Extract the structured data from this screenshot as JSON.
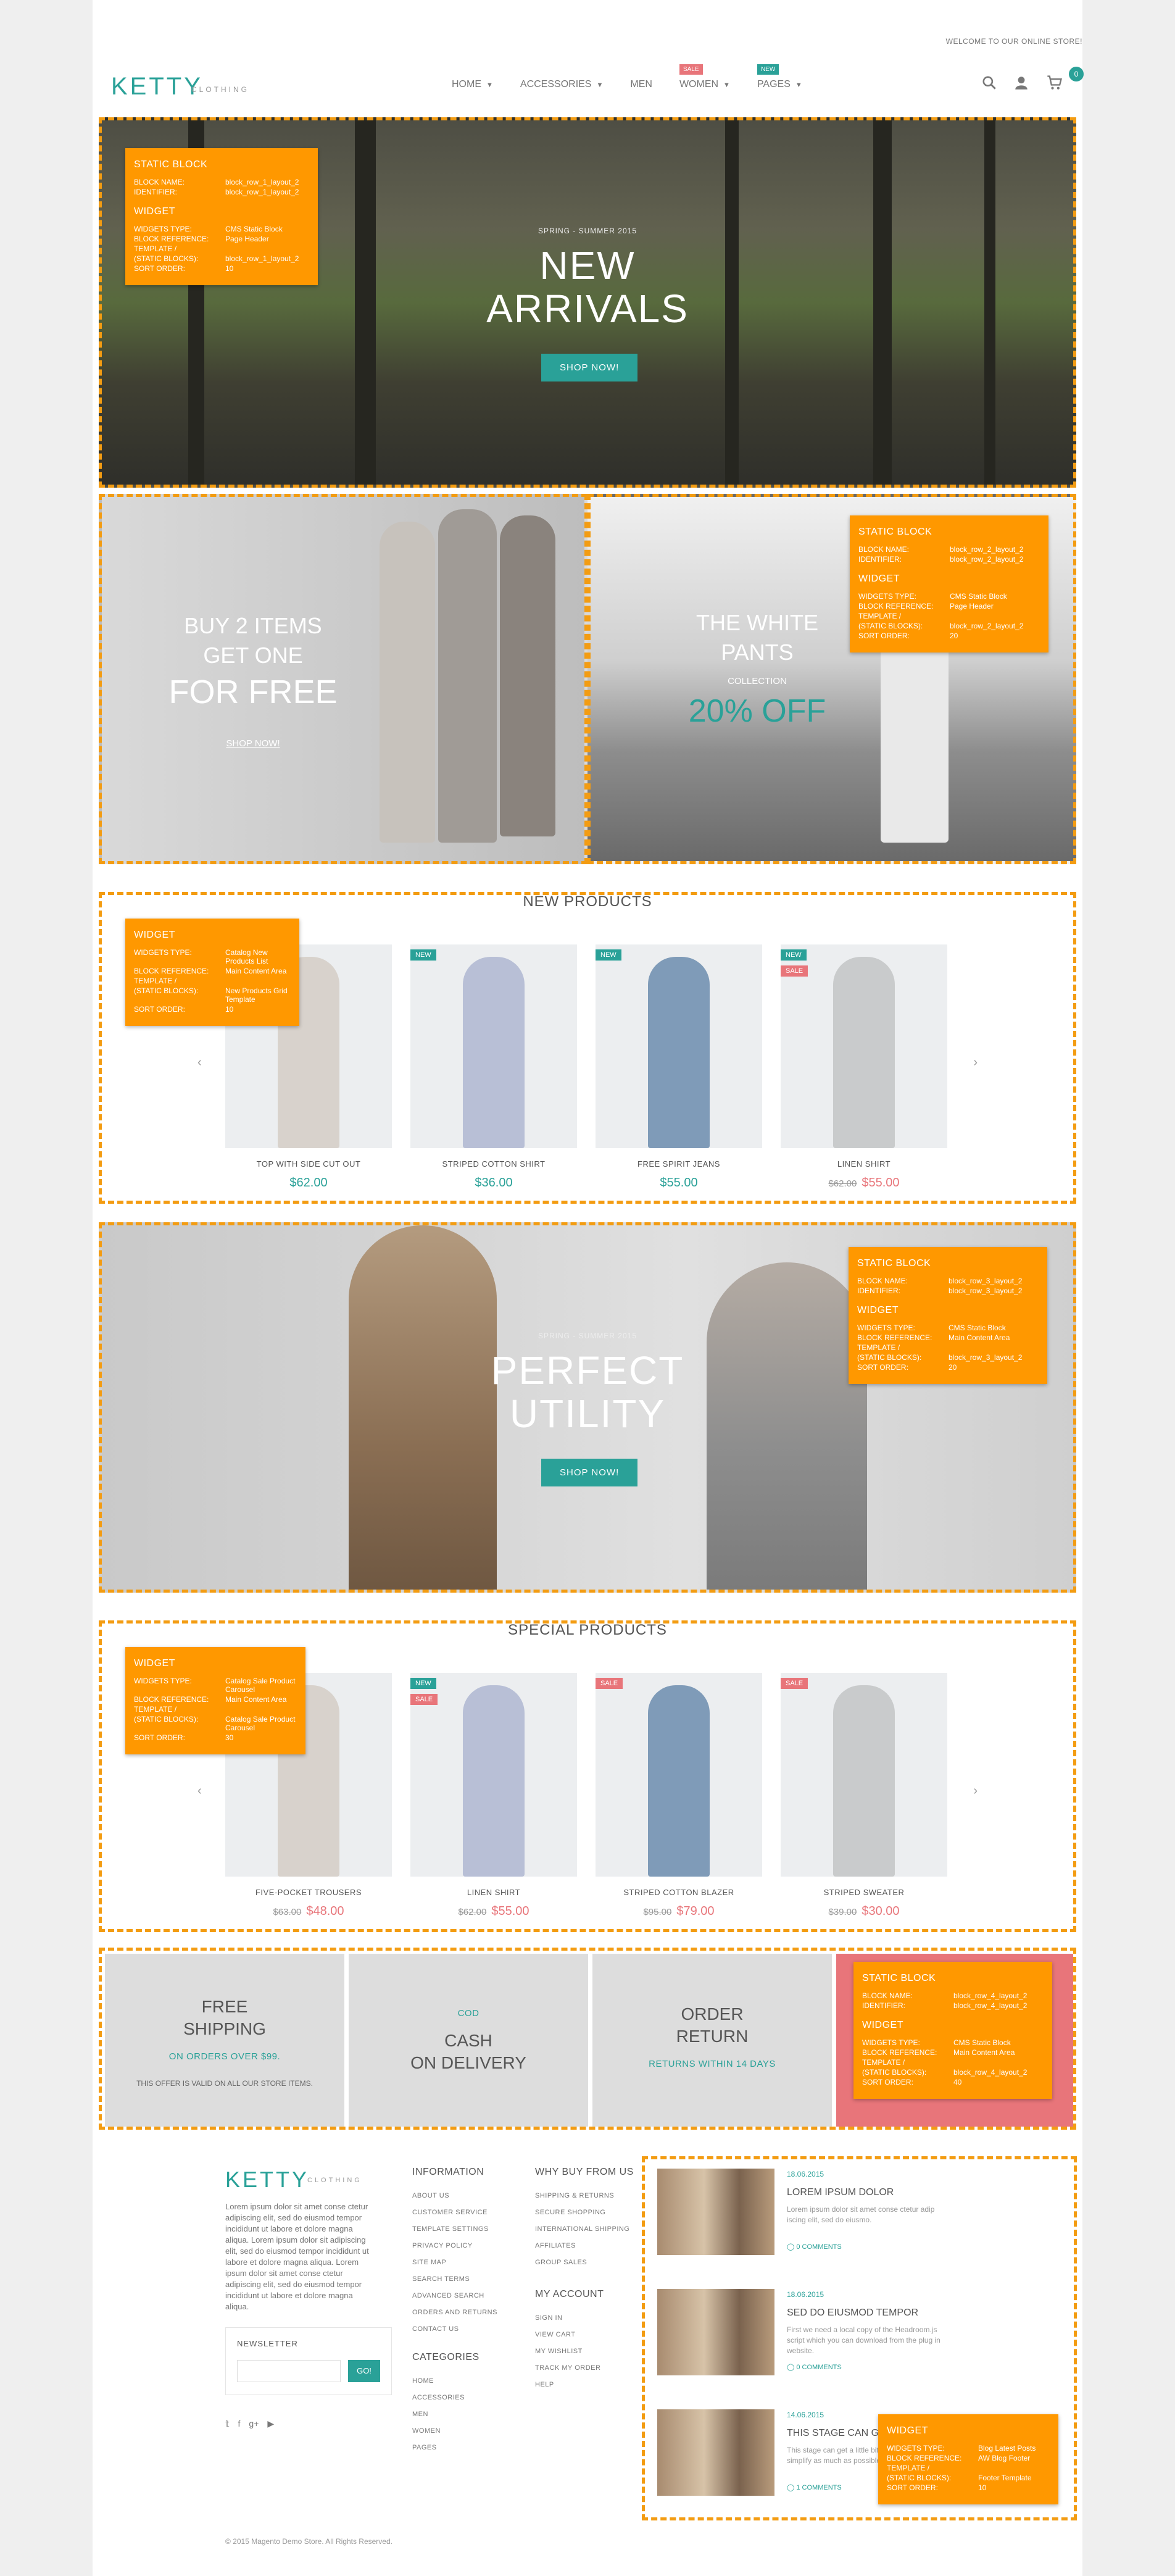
{
  "topbar": {
    "welcome": "WELCOME TO OUR ONLINE STORE!"
  },
  "header": {
    "logo": "KETTY",
    "logo_sub": "CLOTHING",
    "nav": [
      {
        "label": "HOME",
        "caret": true,
        "badge": ""
      },
      {
        "label": "ACCESSORIES",
        "caret": true,
        "badge": ""
      },
      {
        "label": "MEN",
        "caret": false,
        "badge": ""
      },
      {
        "label": "WOMEN",
        "caret": true,
        "badge": "SALE"
      },
      {
        "label": "PAGES",
        "caret": true,
        "badge": "NEW"
      }
    ],
    "cart_count": "0",
    "icons": [
      "search-icon",
      "user-icon",
      "cart-icon"
    ]
  },
  "hero": {
    "pretitle": "SPRING - SUMMER 2015",
    "title_line1": "NEW",
    "title_line2": "ARRIVALS",
    "button": "SHOP NOW!",
    "info": {
      "heading1": "STATIC BLOCK",
      "rows1": [
        [
          "BLOCK NAME:",
          "block_row_1_layout_2"
        ],
        [
          "IDENTIFIER:",
          "block_row_1_layout_2"
        ]
      ],
      "heading2": "WIDGET",
      "rows2": [
        [
          "WIDGETS TYPE:",
          "CMS Static Block"
        ],
        [
          "BLOCK REFERENCE:",
          "Page Header"
        ],
        [
          "TEMPLATE /",
          ""
        ],
        [
          "(STATIC BLOCKS):",
          "block_row_1_layout_2"
        ],
        [
          "SORT ORDER:",
          "10"
        ]
      ]
    }
  },
  "banners": {
    "left": {
      "line1": "BUY 2 ITEMS",
      "line2": "GET ONE",
      "line3": "FOR FREE",
      "link": "SHOP NOW!"
    },
    "right": {
      "line1": "THE WHITE",
      "line2": "PANTS",
      "line3": "COLLECTION",
      "line4": "20% OFF"
    },
    "info": {
      "heading1": "STATIC BLOCK",
      "rows1": [
        [
          "BLOCK NAME:",
          "block_row_2_layout_2"
        ],
        [
          "IDENTIFIER:",
          "block_row_2_layout_2"
        ]
      ],
      "heading2": "WIDGET",
      "rows2": [
        [
          "WIDGETS TYPE:",
          "CMS Static Block"
        ],
        [
          "BLOCK REFERENCE:",
          "Page Header"
        ],
        [
          "TEMPLATE /",
          ""
        ],
        [
          "(STATIC BLOCKS):",
          "block_row_2_layout_2"
        ],
        [
          "SORT ORDER:",
          "20"
        ]
      ]
    }
  },
  "new_products": {
    "title": "NEW PRODUCTS",
    "items": [
      {
        "name": "TOP WITH SIDE CUT OUT",
        "price": "$62.00",
        "old": "",
        "tags": []
      },
      {
        "name": "STRIPED COTTON SHIRT",
        "price": "$36.00",
        "old": "",
        "tags": [
          "NEW"
        ]
      },
      {
        "name": "FREE SPIRIT JEANS",
        "price": "$55.00",
        "old": "",
        "tags": [
          "NEW"
        ]
      },
      {
        "name": "LINEN SHIRT",
        "price": "$55.00",
        "old": "$62.00",
        "tags": [
          "NEW",
          "SALE"
        ]
      }
    ],
    "info": {
      "heading": "WIDGET",
      "rows": [
        [
          "WIDGETS TYPE:",
          "Catalog New Products List"
        ],
        [
          "BLOCK REFERENCE:",
          "Main Content Area"
        ],
        [
          "TEMPLATE /",
          ""
        ],
        [
          "(STATIC BLOCKS):",
          "New Products Grid Template"
        ],
        [
          "SORT ORDER:",
          "10"
        ]
      ]
    }
  },
  "hero2": {
    "pretitle": "SPRING - SUMMER 2015",
    "title_line1": "PERFECT",
    "title_line2": "UTILITY",
    "button": "SHOP NOW!",
    "info": {
      "heading1": "STATIC BLOCK",
      "rows1": [
        [
          "BLOCK NAME:",
          "block_row_3_layout_2"
        ],
        [
          "IDENTIFIER:",
          "block_row_3_layout_2"
        ]
      ],
      "heading2": "WIDGET",
      "rows2": [
        [
          "WIDGETS TYPE:",
          "CMS Static Block"
        ],
        [
          "BLOCK REFERENCE:",
          "Main Content Area"
        ],
        [
          "TEMPLATE /",
          ""
        ],
        [
          "(STATIC BLOCKS):",
          "block_row_3_layout_2"
        ],
        [
          "SORT ORDER:",
          "20"
        ]
      ]
    }
  },
  "special_products": {
    "title": "SPECIAL PRODUCTS",
    "items": [
      {
        "name": "FIVE-POCKET TROUSERS",
        "price": "$48.00",
        "old": "$63.00",
        "tags": []
      },
      {
        "name": "LINEN SHIRT",
        "price": "$55.00",
        "old": "$62.00",
        "tags": [
          "NEW",
          "SALE"
        ]
      },
      {
        "name": "STRIPED COTTON BLAZER",
        "price": "$79.00",
        "old": "$95.00",
        "tags": [
          "SALE"
        ]
      },
      {
        "name": "STRIPED SWEATER",
        "price": "$30.00",
        "old": "$39.00",
        "tags": [
          "SALE"
        ]
      }
    ],
    "info": {
      "heading": "WIDGET",
      "rows": [
        [
          "WIDGETS TYPE:",
          "Catalog Sale Product Carousel"
        ],
        [
          "BLOCK REFERENCE:",
          "Main Content Area"
        ],
        [
          "TEMPLATE /",
          ""
        ],
        [
          "(STATIC BLOCKS):",
          "Catalog Sale Product Carousel"
        ],
        [
          "SORT ORDER:",
          "30"
        ]
      ]
    }
  },
  "features": {
    "items": [
      {
        "t1a": "FREE",
        "t1b": "SHIPPING",
        "t2": "ON ORDERS OVER $99.",
        "t3": "THIS OFFER IS VALID ON ALL OUR STORE ITEMS."
      },
      {
        "pre": "COD",
        "t1a": "CASH",
        "t1b": "ON DELIVERY",
        "t2": "",
        "t3": ""
      },
      {
        "t1a": "ORDER",
        "t1b": "RETURN",
        "t2": "RETURNS WITHIN 14 DAYS",
        "t3": ""
      }
    ],
    "info": {
      "heading1": "STATIC BLOCK",
      "rows1": [
        [
          "BLOCK NAME:",
          "block_row_4_layout_2"
        ],
        [
          "IDENTIFIER:",
          "block_row_4_layout_2"
        ]
      ],
      "heading2": "WIDGET",
      "rows2": [
        [
          "WIDGETS TYPE:",
          "CMS Static Block"
        ],
        [
          "BLOCK REFERENCE:",
          "Main Content Area"
        ],
        [
          "TEMPLATE /",
          ""
        ],
        [
          "(STATIC BLOCKS):",
          "block_row_4_layout_2"
        ],
        [
          "SORT ORDER:",
          "40"
        ]
      ]
    }
  },
  "footer": {
    "logo": "KETTY",
    "logo_sub": "CLOTHING",
    "about": "Lorem ipsum dolor sit amet conse ctetur adipiscing elit, sed do eiusmod tempor incididunt ut labore et dolore magna aliqua. Lorem ipsum dolor sit adipiscing elit, sed do eiusmod tempor incididunt ut labore et dolore magna aliqua. Lorem ipsum dolor sit amet conse ctetur adipiscing elit, sed do eiusmod tempor incididunt ut labore et dolore magna aliqua.",
    "newsletter_label": "NEWSLETTER",
    "newsletter_button": "GO!",
    "social_icons": [
      "twitter-icon",
      "facebook-icon",
      "google-plus-icon",
      "youtube-icon"
    ],
    "social_glyphs": [
      "𝕥",
      "f",
      "g+",
      "▶"
    ],
    "information": {
      "title": "INFORMATION",
      "links": [
        "ABOUT US",
        "CUSTOMER SERVICE",
        "TEMPLATE SETTINGS",
        "PRIVACY POLICY",
        "SITE MAP",
        "SEARCH TERMS",
        "ADVANCED SEARCH",
        "ORDERS AND RETURNS",
        "CONTACT US"
      ]
    },
    "categories": {
      "title": "CATEGORIES",
      "links": [
        "HOME",
        "ACCESSORIES",
        "MEN",
        "WOMEN",
        "PAGES"
      ]
    },
    "why": {
      "title": "WHY BUY FROM US",
      "links": [
        "SHIPPING & RETURNS",
        "SECURE SHOPPING",
        "INTERNATIONAL SHIPPING",
        "AFFILIATES",
        "GROUP SALES"
      ]
    },
    "account": {
      "title": "MY ACCOUNT",
      "links": [
        "SIGN IN",
        "VIEW CART",
        "MY WISHLIST",
        "TRACK MY ORDER",
        "HELP"
      ]
    },
    "copyright": "© 2015 Magento Demo Store. All Rights Reserved."
  },
  "blog": {
    "posts": [
      {
        "date": "18.06.2015",
        "title": "LOREM IPSUM DOLOR",
        "excerpt": "Lorem ipsum dolor sit amet conse ctetur adip iscing elit, sed do eiusmo.",
        "comments": "0 COMMENTS"
      },
      {
        "date": "18.06.2015",
        "title": "SED DO EIUSMOD TEMPOR",
        "excerpt": "First we need a local copy of the Headroom.js script which you can download from the plug in website.",
        "comments": "0 COMMENTS"
      },
      {
        "date": "14.06.2015",
        "title": "THIS STAGE CAN GET",
        "excerpt": "This stage can get a little bit tricky, so try to simplify as much as possible.",
        "comments": "1 COMMENTS"
      }
    ],
    "info": {
      "heading": "WIDGET",
      "rows": [
        [
          "WIDGETS TYPE:",
          "Blog Latest Posts"
        ],
        [
          "BLOCK REFERENCE:",
          "AW Blog Footer"
        ],
        [
          "TEMPLATE /",
          ""
        ],
        [
          "(STATIC BLOCKS):",
          "Footer Template"
        ],
        [
          "SORT ORDER:",
          "10"
        ]
      ]
    }
  },
  "colors": {
    "accent": "#2aa198",
    "sale": "#e8757a",
    "annotation": "#ff9800"
  }
}
